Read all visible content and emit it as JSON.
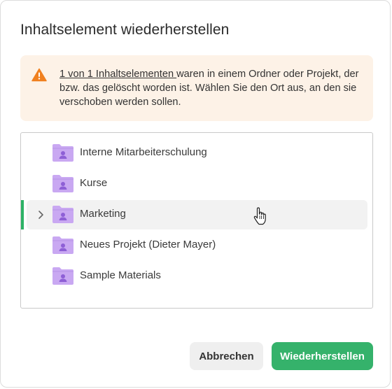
{
  "dialog": {
    "title": "Inhaltselement wiederherstellen"
  },
  "warning": {
    "icon": "warning-triangle-icon",
    "icon_color": "#f0801f",
    "link_text": "1 von 1 Inhaltselementen ",
    "text": "waren in einem Ordner oder Projekt, der bzw. das gelöscht worden ist. Wählen Sie den Ort aus, an den sie verschoben werden sollen.",
    "background": "#fdf2e7"
  },
  "tree": {
    "items": [
      {
        "label": "Interne Mitarbeiterschulung",
        "icon": "shared-folder-icon",
        "selected": false,
        "expandable": false
      },
      {
        "label": "Kurse",
        "icon": "shared-folder-icon",
        "selected": false,
        "expandable": false
      },
      {
        "label": "Marketing",
        "icon": "shared-folder-icon",
        "selected": true,
        "expandable": true
      },
      {
        "label": "Neues Projekt (Dieter Mayer)",
        "icon": "shared-folder-icon",
        "selected": false,
        "expandable": false
      },
      {
        "label": "Sample Materials",
        "icon": "shared-folder-icon",
        "selected": false,
        "expandable": false
      }
    ],
    "folder_color": "#c9a8f2",
    "selection_color": "#2eb266"
  },
  "buttons": {
    "cancel_label": "Abbrechen",
    "restore_label": "Wiederherstellen",
    "primary_color": "#35b26b"
  }
}
